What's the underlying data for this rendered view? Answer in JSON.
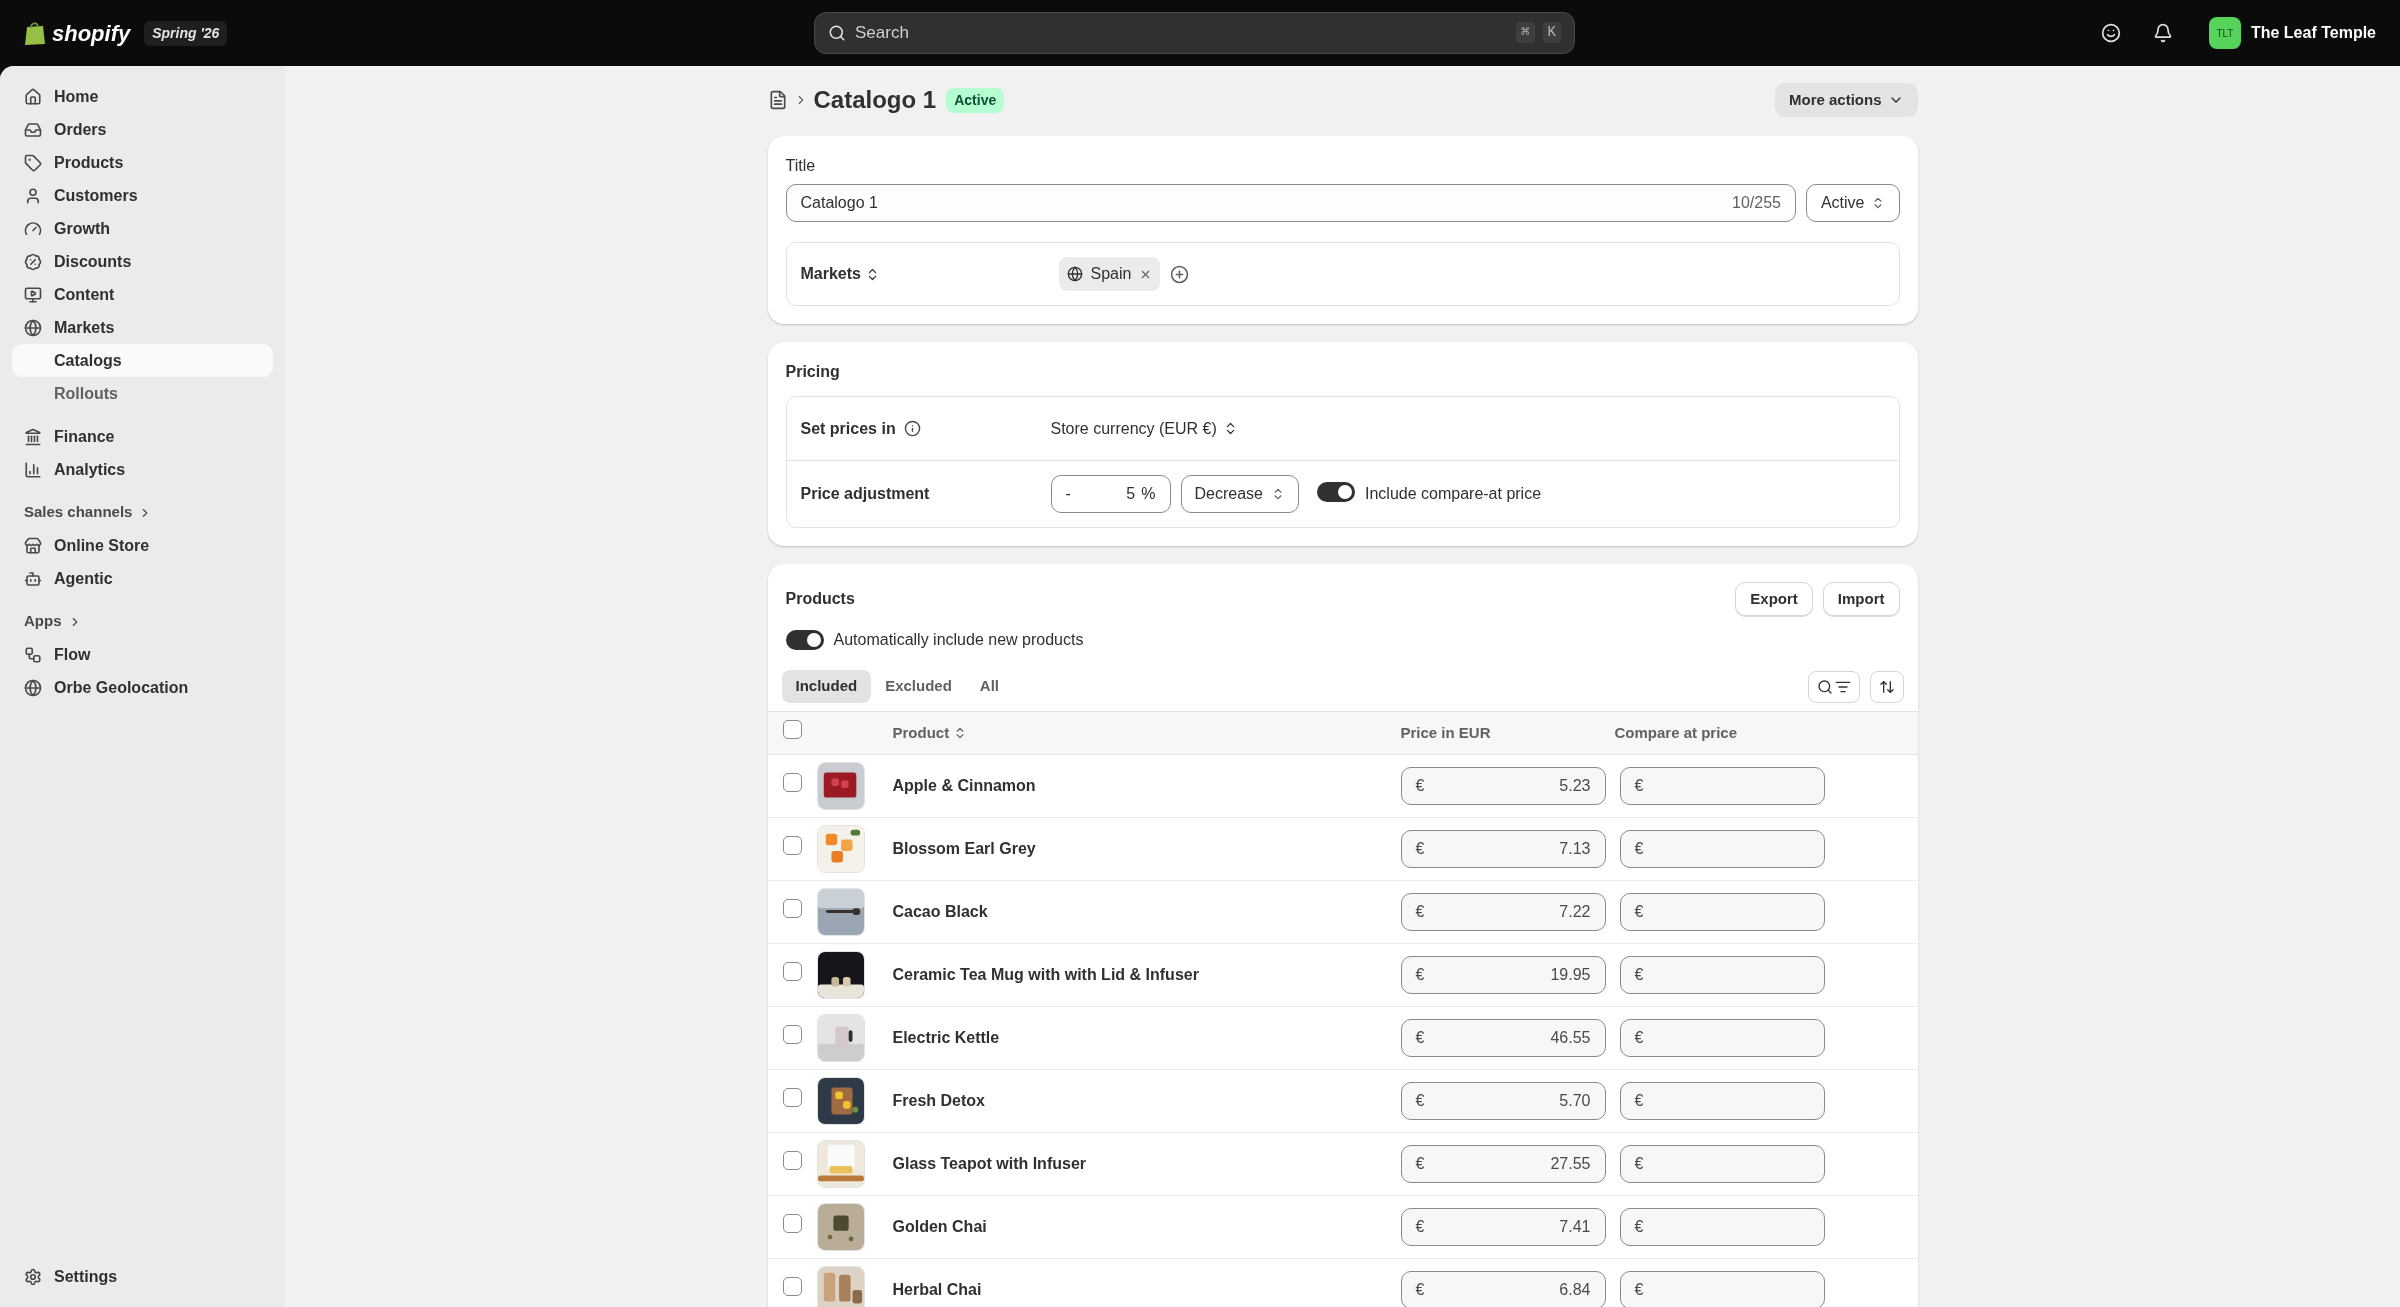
{
  "topbar": {
    "logo": "shopify",
    "edition": "Spring '26",
    "search": {
      "placeholder": "Search",
      "keys": [
        "⌘",
        "K"
      ]
    },
    "store": {
      "initials": "TLT",
      "name": "The Leaf Temple"
    }
  },
  "sidebar": {
    "groups": [
      {
        "items": [
          {
            "label": "Home",
            "selected": false
          },
          {
            "label": "Orders",
            "selected": false
          },
          {
            "label": "Products",
            "selected": false
          },
          {
            "label": "Customers",
            "selected": false
          },
          {
            "label": "Growth",
            "selected": false
          },
          {
            "label": "Discounts",
            "selected": false
          },
          {
            "label": "Content",
            "selected": false
          },
          {
            "label": "Markets",
            "selected": false,
            "children": [
              {
                "label": "Catalogs",
                "selected": true
              },
              {
                "label": "Rollouts",
                "selected": false
              }
            ]
          }
        ]
      },
      {
        "items": [
          {
            "label": "Finance",
            "selected": false
          },
          {
            "label": "Analytics",
            "selected": false
          }
        ]
      },
      {
        "heading": "Sales channels",
        "items": [
          {
            "label": "Online Store",
            "selected": false
          },
          {
            "label": "Agentic",
            "selected": false
          }
        ]
      },
      {
        "heading": "Apps",
        "items": [
          {
            "label": "Flow",
            "selected": false
          },
          {
            "label": "Orbe Geolocation",
            "selected": false
          }
        ]
      }
    ],
    "footer": {
      "label": "Settings",
      "selected": false
    }
  },
  "page": {
    "title": "Catalogo 1",
    "badge": "Active",
    "more_actions": "More actions"
  },
  "details": {
    "title_label": "Title",
    "title_value": "Catalogo 1",
    "counter": "10/255",
    "status": "Active",
    "markets_label": "Markets",
    "markets": [
      {
        "label": "Spain"
      }
    ]
  },
  "pricing": {
    "heading": "Pricing",
    "currency_label": "Set prices in",
    "currency": "Store currency (EUR €)",
    "adjustment_label": "Price adjustment",
    "sign": "-",
    "amount": "5",
    "unit": "%",
    "direction": "Decrease",
    "compare_at": {
      "on": true,
      "label": "Include compare-at price"
    }
  },
  "products": {
    "heading": "Products",
    "buttons": [
      "Export",
      "Import"
    ],
    "auto_include": {
      "on": true,
      "label": "Automatically include new products"
    },
    "tabs": [
      {
        "label": "Included",
        "selected": true
      },
      {
        "label": "Excluded",
        "selected": false
      },
      {
        "label": "All",
        "selected": false
      }
    ],
    "columns": [
      "Product",
      "Price in EUR",
      "Compare at price"
    ],
    "all_checked": false,
    "rows": [
      {
        "name": "Apple & Cinnamon",
        "checked": false,
        "currency": "€",
        "price": "5.23",
        "compare_currency": "€"
      },
      {
        "name": "Blossom Earl Grey",
        "checked": false,
        "currency": "€",
        "price": "7.13",
        "compare_currency": "€"
      },
      {
        "name": "Cacao Black",
        "checked": false,
        "currency": "€",
        "price": "7.22",
        "compare_currency": "€"
      },
      {
        "name": "Ceramic Tea Mug with with Lid & Infuser",
        "checked": false,
        "currency": "€",
        "price": "19.95",
        "compare_currency": "€"
      },
      {
        "name": "Electric Kettle",
        "checked": false,
        "currency": "€",
        "price": "46.55",
        "compare_currency": "€"
      },
      {
        "name": "Fresh Detox",
        "checked": false,
        "currency": "€",
        "price": "5.70",
        "compare_currency": "€"
      },
      {
        "name": "Glass Teapot with Infuser",
        "checked": false,
        "currency": "€",
        "price": "27.55",
        "compare_currency": "€"
      },
      {
        "name": "Golden Chai",
        "checked": false,
        "currency": "€",
        "price": "7.41",
        "compare_currency": "€"
      },
      {
        "name": "Herbal Chai",
        "checked": false,
        "currency": "€",
        "price": "6.84",
        "compare_currency": "€"
      }
    ]
  }
}
